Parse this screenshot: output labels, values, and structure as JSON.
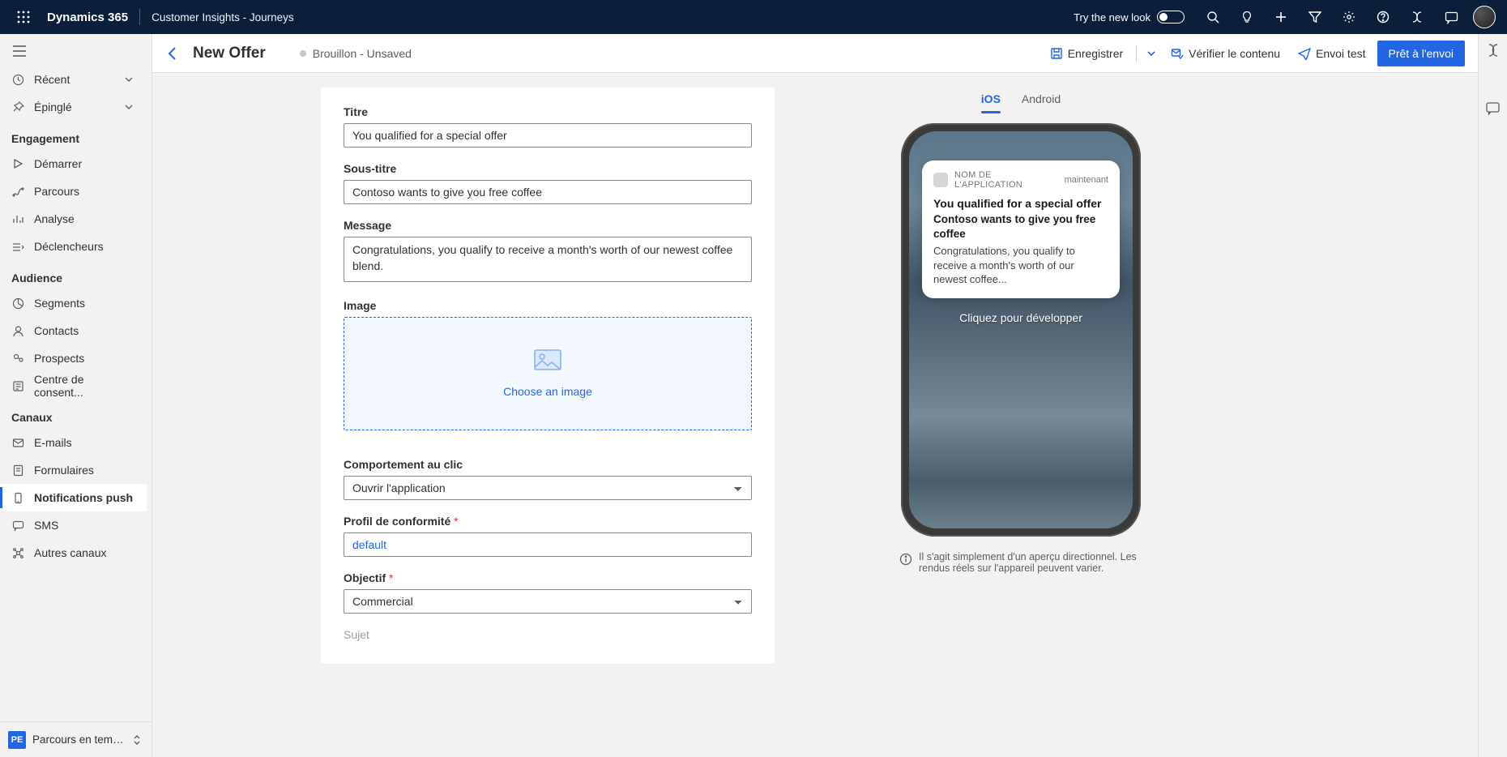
{
  "topbar": {
    "brand": "Dynamics 365",
    "subbrand": "Customer Insights - Journeys",
    "try_new_look": "Try the new look"
  },
  "nav": {
    "recent": "Récent",
    "pinned": "Épinglé",
    "sections": {
      "engagement": "Engagement",
      "audience": "Audience",
      "canaux": "Canaux"
    },
    "items": {
      "demarrer": "Démarrer",
      "parcours": "Parcours",
      "analyse": "Analyse",
      "declencheurs": "Déclencheurs",
      "segments": "Segments",
      "contacts": "Contacts",
      "prospects": "Prospects",
      "consent": "Centre de consent...",
      "emails": "E-mails",
      "formulaires": "Formulaires",
      "push": "Notifications push",
      "sms": "SMS",
      "other": "Autres canaux"
    },
    "footer": {
      "badge": "PE",
      "label": "Parcours en temp..."
    }
  },
  "cmdbar": {
    "title": "New Offer",
    "status": "Brouillon - Unsaved",
    "save": "Enregistrer",
    "verify": "Vérifier le contenu",
    "test_send": "Envoi test",
    "ready": "Prêt à l'envoi"
  },
  "form": {
    "titre_label": "Titre",
    "titre_value": "You qualified for a special offer",
    "soustitre_label": "Sous-titre",
    "soustitre_value": "Contoso wants to give you free coffee",
    "message_label": "Message",
    "message_value": "Congratulations, you qualify to receive a month's worth of our newest coffee blend.",
    "image_label": "Image",
    "choose_image": "Choose an image",
    "click_label": "Comportement au clic",
    "click_value": "Ouvrir l'application",
    "compliance_label": "Profil de conformité",
    "compliance_value": "default",
    "objectif_label": "Objectif",
    "objectif_value": "Commercial",
    "sujet_label": "Sujet"
  },
  "preview": {
    "tab_ios": "iOS",
    "tab_android": "Android",
    "app_name": "NOM DE L'APPLICATION",
    "app_time": "maintenant",
    "notif_title": "You qualified for a special offer",
    "notif_sub": "Contoso wants to give you free coffee",
    "notif_body": "Congratulations, you qualify to receive a month's worth of our newest coffee...",
    "expand": "Cliquez pour développer",
    "note": "Il s'agit simplement d'un aperçu directionnel. Les rendus réels sur l'appareil peuvent varier."
  }
}
